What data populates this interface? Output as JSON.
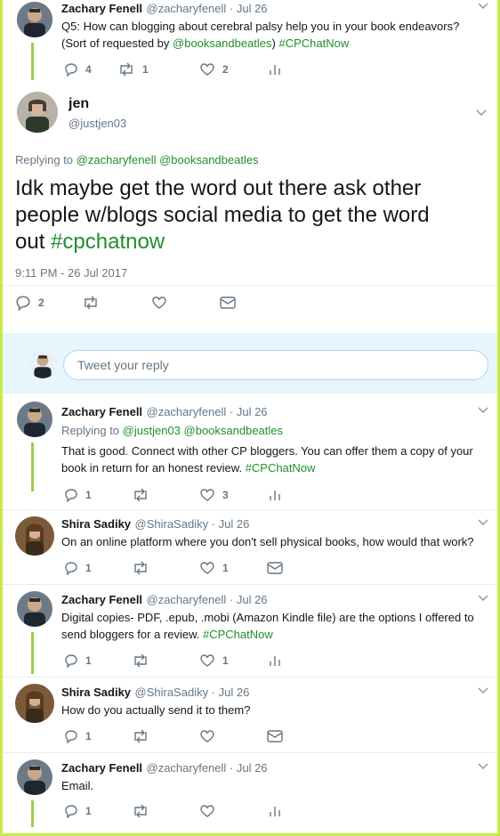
{
  "tweets": [
    {
      "name": "Zachary Fenell",
      "handle": "@zacharyfenell · Jul 26",
      "text_pre": "Q5: How can blogging about cerebral palsy help you in your book endeavors?",
      "text2_pre": "(Sort of requested by ",
      "mention": "@booksandbeatles",
      "text2_mid": ")",
      "tag": "#CPChatNow",
      "replies": "4",
      "retweets": "1",
      "likes": "2"
    },
    {
      "name": "Zachary Fenell",
      "handle": "@zacharyfenell · Jul 26",
      "replying_label": "Replying to",
      "replying_to": "@justjen03 @booksandbeatles",
      "line1": "That is good. Connect with other CP bloggers. You can offer them a copy of your",
      "line2": "book in return for an honest review.",
      "tag": "#CPChatNow",
      "replies": "1",
      "retweets": "",
      "likes": "3"
    },
    {
      "name": "Shira Sadiky",
      "handle": "@ShiraSadiky · Jul 26",
      "line1": "On an online platform where you don't sell physical books, how would that work?",
      "replies": "1",
      "retweets": "",
      "likes": "1"
    },
    {
      "name": "Zachary Fenell",
      "handle": "@zacharyfenell · Jul 26",
      "line1": "Digital copies- PDF, .epub, .mobi (Amazon Kindle file) are the options I offered to",
      "line2": "send bloggers for a review.",
      "tag": "#CPChatNow",
      "replies": "1",
      "retweets": "",
      "likes": "1"
    },
    {
      "name": "Shira Sadiky",
      "handle": "@ShiraSadiky · Jul 26",
      "line1": "How do you actually send it to them?",
      "replies": "1",
      "retweets": "",
      "likes": ""
    },
    {
      "name": "Zachary Fenell",
      "handle": "@zacharyfenell · Jul 26",
      "line1": "Email.",
      "replies": "1",
      "retweets": "",
      "likes": ""
    }
  ],
  "main_tweet": {
    "name": "jen",
    "handle": "@justjen03",
    "replying_label": "Replying to",
    "replying_to": "@zacharyfenell @booksandbeatles",
    "line1": "Idk maybe get the word out there ask other",
    "line2": "people w/blogs social media to get the word",
    "line3_pre": "out",
    "tag": "#cpchatnow",
    "timestamp": "9:11 PM - 26 Jul 2017",
    "replies": "2"
  },
  "reply_box": {
    "placeholder": "Tweet your reply"
  },
  "colors": {
    "accent_green": "#1f8f2d",
    "frame": "#c5ec45",
    "thread_line": "#9bcd4a"
  }
}
